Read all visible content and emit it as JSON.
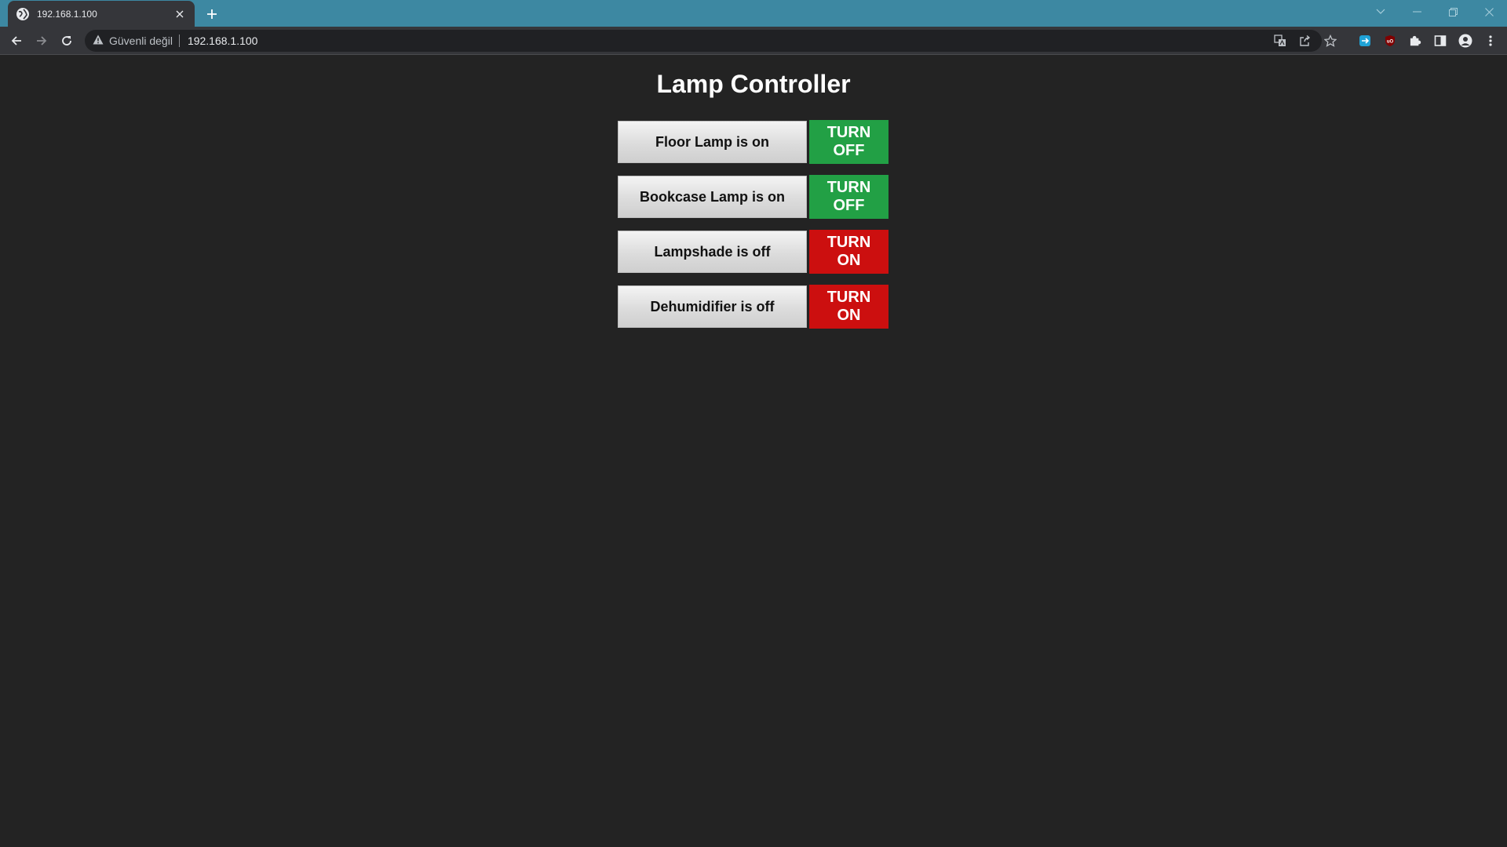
{
  "browser": {
    "tab": {
      "title": "192.168.1.100"
    },
    "address_bar": {
      "security_label": "Güvenli değil",
      "url": "192.168.1.100"
    }
  },
  "page": {
    "title": "Lamp Controller",
    "devices": [
      {
        "status_label": "Floor Lamp is on",
        "button_line1": "TURN",
        "button_line2": "OFF",
        "state": "on",
        "button_color": "#22a045"
      },
      {
        "status_label": "Bookcase Lamp is on",
        "button_line1": "TURN",
        "button_line2": "OFF",
        "state": "on",
        "button_color": "#22a045"
      },
      {
        "status_label": "Lampshade is off",
        "button_line1": "TURN",
        "button_line2": "ON",
        "state": "off",
        "button_color": "#cc0f0f"
      },
      {
        "status_label": "Dehumidifier is off",
        "button_line1": "TURN",
        "button_line2": "ON",
        "state": "off",
        "button_color": "#cc0f0f"
      }
    ]
  },
  "colors": {
    "tabstrip": "#3d88a2",
    "toolbar": "#35363a",
    "page_background": "#232323",
    "on_button": "#22a045",
    "off_button": "#cc0f0f"
  },
  "icons": {
    "tab_favicon": "globe-icon",
    "tab_close": "close-icon",
    "new_tab": "plus-icon",
    "back": "arrow-left-icon",
    "forward": "arrow-right-icon",
    "reload": "reload-icon",
    "security": "warning-triangle-icon",
    "translate": "translate-icon",
    "share": "share-icon",
    "bookmark": "star-icon",
    "extensions": "puzzle-icon",
    "side_panel": "side-panel-icon",
    "profile": "profile-icon",
    "menu": "kebab-menu-icon"
  }
}
